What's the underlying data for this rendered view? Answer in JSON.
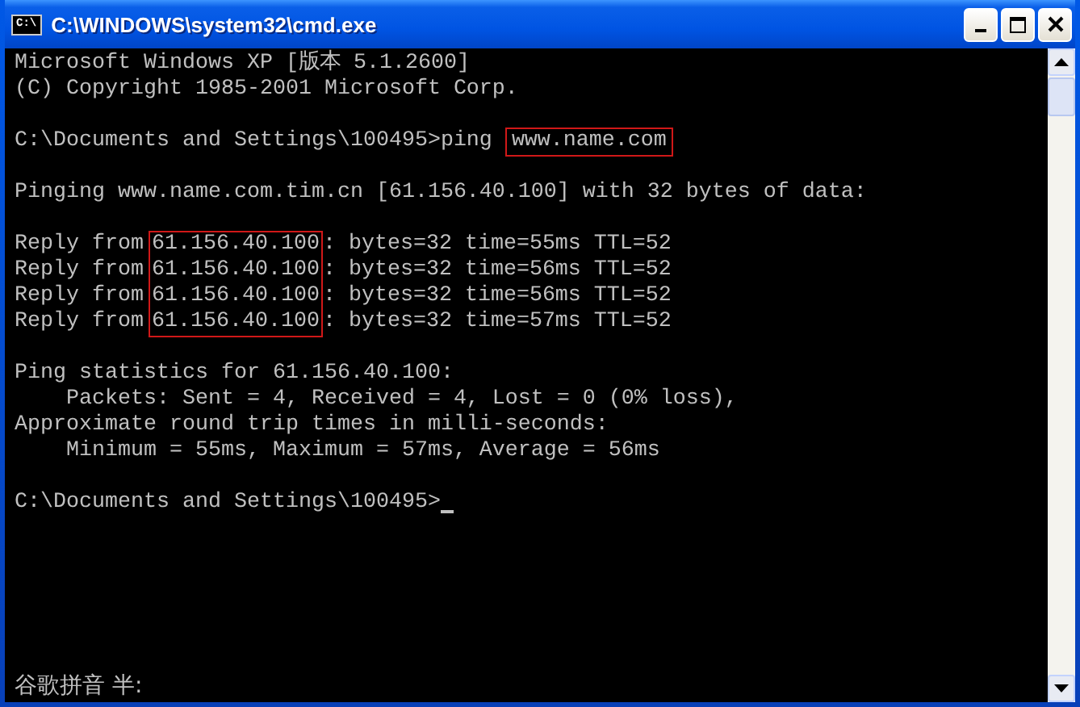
{
  "window": {
    "title": "C:\\WINDOWS\\system32\\cmd.exe",
    "icon_text": "C:\\"
  },
  "lines": [
    {
      "kind": "text",
      "text": "Microsoft Windows XP [版本 5.1.2600]"
    },
    {
      "kind": "text",
      "text": "(C) Copyright 1985-2001 Microsoft Corp."
    },
    {
      "kind": "blank"
    },
    {
      "kind": "command",
      "prompt": "C:\\Documents and Settings\\100495>ping ",
      "command": "www.name.com",
      "highlighted": true
    },
    {
      "kind": "blank"
    },
    {
      "kind": "text",
      "text": "Pinging www.name.com.tim.cn [61.156.40.100] with 32 bytes of data:"
    },
    {
      "kind": "blank"
    },
    {
      "kind": "replies",
      "highlighted": true,
      "rows": [
        {
          "prefix": "Reply from",
          "address": "61.156.40.100",
          "rest": ": bytes=32 time=55ms TTL=52"
        },
        {
          "prefix": "Reply from",
          "address": "61.156.40.100",
          "rest": ": bytes=32 time=56ms TTL=52"
        },
        {
          "prefix": "Reply from",
          "address": "61.156.40.100",
          "rest": ": bytes=32 time=56ms TTL=52"
        },
        {
          "prefix": "Reply from",
          "address": "61.156.40.100",
          "rest": ": bytes=32 time=57ms TTL=52"
        }
      ]
    },
    {
      "kind": "blank"
    },
    {
      "kind": "text",
      "text": "Ping statistics for 61.156.40.100:"
    },
    {
      "kind": "text",
      "text": "    Packets: Sent = 4, Received = 4, Lost = 0 (0% loss),"
    },
    {
      "kind": "text",
      "text": "Approximate round trip times in milli-seconds:"
    },
    {
      "kind": "text",
      "text": "    Minimum = 55ms, Maximum = 57ms, Average = 56ms"
    },
    {
      "kind": "blank"
    },
    {
      "kind": "command",
      "prompt": "C:\\Documents and Settings\\100495>",
      "cursor": true
    }
  ],
  "ime_status": "谷歌拼音 半:"
}
